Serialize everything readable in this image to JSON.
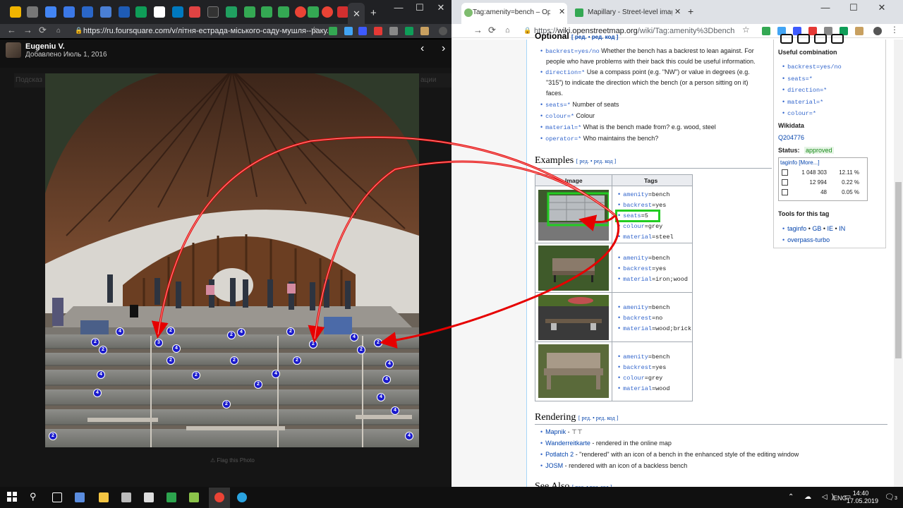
{
  "left_window": {
    "url": "https://ru.foursquare.com/v/літня-естрада-міського-саду-мушля--раку...",
    "tab_close": "✕",
    "new_tab": "+",
    "controls": [
      "—",
      "☐",
      "✕"
    ],
    "user_name": "Eugeniu V.",
    "date": "Добавлено Июль 1, 2016",
    "prev": "‹",
    "next": "›",
    "flag": "Flag this Photo",
    "bg_strip": "Подсказ",
    "bg_strip_right": "ации"
  },
  "photo": {
    "markers": [
      {
        "label": "4"
      },
      {
        "label": "2"
      },
      {
        "label": "2"
      },
      {
        "label": "4"
      },
      {
        "label": "2"
      },
      {
        "label": "4"
      },
      {
        "label": "2"
      },
      {
        "label": "2"
      },
      {
        "label": "3"
      },
      {
        "label": "4"
      },
      {
        "label": "4"
      },
      {
        "label": "2"
      },
      {
        "label": "2"
      },
      {
        "label": "4"
      },
      {
        "label": "2"
      },
      {
        "label": "2"
      },
      {
        "label": "2"
      },
      {
        "label": "4"
      },
      {
        "label": "2"
      },
      {
        "label": "4"
      },
      {
        "label": "4"
      },
      {
        "label": "2"
      },
      {
        "label": "4"
      },
      {
        "label": "4"
      },
      {
        "label": "2"
      },
      {
        "label": "4"
      },
      {
        "label": "2"
      },
      {
        "label": "4"
      },
      {
        "label": "2"
      },
      {
        "label": "2"
      }
    ]
  },
  "right_window": {
    "tab1": "Tag:amenity=bench – OpenStre",
    "tab2": "Mapillary - Street-level imagery,",
    "url_prefix": "https://",
    "url_host": "wiki.openstreetmap.org",
    "url_path": "/wiki/Tag:amenity%3Dbench",
    "controls": [
      "—",
      "☐",
      "✕"
    ]
  },
  "wiki": {
    "optional_heading": "Optional",
    "edit_links": "[ ред. • ред. код ]",
    "keys": [
      {
        "key": "backrest=yes/no",
        "desc": " Whether the bench has a backrest to lean against. For"
      },
      {
        "key": "",
        "desc": "people who have problems with their back this could be useful information."
      },
      {
        "key": "direction=*",
        "desc": " Use a compass point (e.g. \"NW\") or value in degrees (e.g."
      },
      {
        "key": "",
        "desc": "\"315\") to indicate the direction which the bench (or a person sitting on it)"
      },
      {
        "key": "",
        "desc": "faces."
      },
      {
        "key": "seats=*",
        "desc": " Number of seats"
      },
      {
        "key": "colour=*",
        "desc": " Colour"
      },
      {
        "key": "material=*",
        "desc": " What is the bench made from? e.g. wood, steel"
      },
      {
        "key": "operator=*",
        "desc": " Who maintains the bench?"
      }
    ],
    "examples_heading": "Examples",
    "table_headers": [
      "Image",
      "Tags"
    ],
    "examples": [
      {
        "tags": [
          [
            "amenity",
            "bench"
          ],
          [
            "backrest",
            "yes"
          ],
          [
            "seats",
            "5"
          ],
          [
            "colour",
            "grey"
          ],
          [
            "material",
            "steel"
          ]
        ]
      },
      {
        "tags": [
          [
            "amenity",
            "bench"
          ],
          [
            "backrest",
            "yes"
          ],
          [
            "material",
            "iron;wood"
          ]
        ]
      },
      {
        "tags": [
          [
            "amenity",
            "bench"
          ],
          [
            "backrest",
            "no"
          ],
          [
            "material",
            "wood;brick"
          ]
        ]
      },
      {
        "tags": [
          [
            "amenity",
            "bench"
          ],
          [
            "backrest",
            "yes"
          ],
          [
            "colour",
            "grey"
          ],
          [
            "material",
            "wood"
          ]
        ]
      }
    ],
    "rendering_heading": "Rendering",
    "rendering": [
      {
        "link": "Mapnik",
        "desc": " - ⊤⊤"
      },
      {
        "link": "Wanderreitkarte",
        "desc": " - rendered in the online map"
      },
      {
        "link": "Potlatch 2",
        "desc": " - \"rendered\" with an icon of a bench in the enhanced style of the editing window"
      },
      {
        "link": "JOSM",
        "desc": " - rendered with an icon of a backless bench"
      }
    ],
    "see_also_heading": "See Also",
    "sidebar": {
      "useful_heading": "Useful combination",
      "useful": [
        "backrest=yes/no",
        "seats=*",
        "direction=*",
        "material=*",
        "colour=*"
      ],
      "wikidata_heading": "Wikidata",
      "wikidata_id": "Q204776",
      "status_label": "Status: ",
      "status_value": "approved",
      "taginfo_label": "taginfo",
      "taginfo_more": "[More...]",
      "taginfo_rows": [
        {
          "count": "1 048 303",
          "pct": "12.11 %"
        },
        {
          "count": "12 994",
          "pct": "0.22 %"
        },
        {
          "count": "48",
          "pct": "0.05 %"
        }
      ],
      "tools_heading": "Tools for this tag",
      "tools": [
        "taginfo",
        "GB",
        "IE",
        "IN"
      ],
      "overpass": "overpass-turbo"
    }
  },
  "taskbar": {
    "lang": "ENG",
    "time": "14:40",
    "date": "17.05.2019",
    "notif_count": "3"
  },
  "colors": {
    "arrow": "#e60000",
    "highlight": "#22cc22",
    "marker": "#1a1acc"
  }
}
